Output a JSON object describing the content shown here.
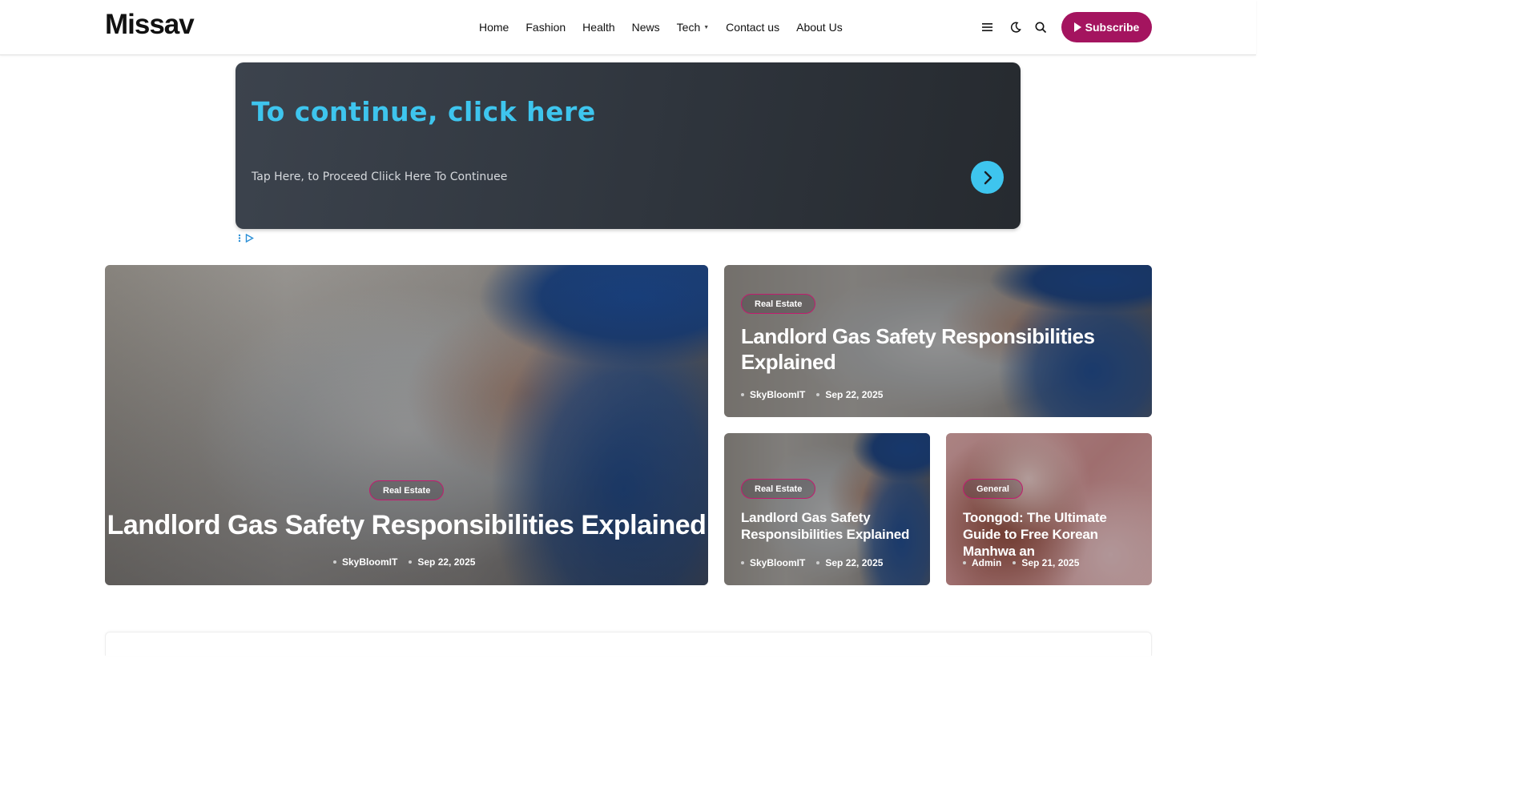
{
  "site": {
    "logo": "Missav"
  },
  "nav": {
    "items": [
      "Home",
      "Fashion",
      "Health",
      "News",
      "Tech",
      "Contact us",
      "About Us"
    ],
    "tech_has_dropdown": true
  },
  "header_actions": {
    "icons": [
      "menu-icon",
      "dark-mode-moon-icon",
      "search-icon"
    ],
    "subscribe_label": "Subscribe",
    "subscribe_color": "#a4145f"
  },
  "ad": {
    "headline": "To continue, click here",
    "subtext": "Tap Here, to Proceed Cliick Here To Continuee",
    "accent": "#3ec5ee"
  },
  "featured": {
    "main": {
      "category": "Real Estate",
      "title": "Landlord Gas Safety Responsibilities Explained",
      "author": "SkyBloomIT",
      "date": "Sep 22, 2025"
    },
    "top_right": {
      "category": "Real Estate",
      "title": "Landlord Gas Safety Responsibilities Explained",
      "author": "SkyBloomIT",
      "date": "Sep 22, 2025"
    },
    "bottom_left": {
      "category": "Real Estate",
      "title": "Landlord Gas Safety Responsibilities Explained",
      "author": "SkyBloomIT",
      "date": "Sep 22, 2025"
    },
    "bottom_right": {
      "category": "General",
      "title": "Toongod: The Ultimate Guide to Free Korean Manhwa an",
      "author": "Admin",
      "date": "Sep 21, 2025"
    }
  }
}
